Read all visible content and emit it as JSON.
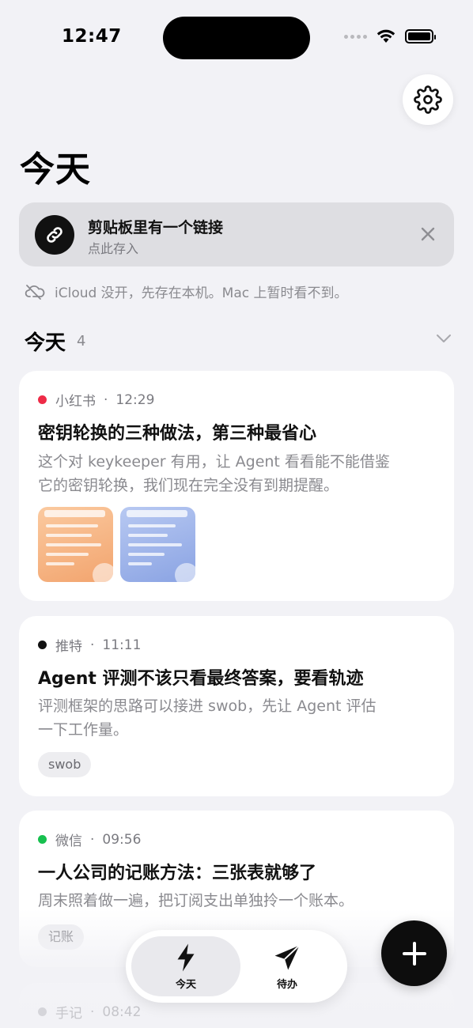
{
  "status_bar": {
    "time": "12:47"
  },
  "header": {
    "title": "今天",
    "settings_icon": "gear-icon"
  },
  "clipboard_banner": {
    "icon": "link-icon",
    "title": "剪贴板里有一个链接",
    "subtitle": "点此存入",
    "close_icon": "close-icon"
  },
  "icloud_notice": {
    "icon": "cloud-off-icon",
    "text": "iCloud 没开，先存在本机。Mac 上暂时看不到。"
  },
  "section": {
    "title": "今天",
    "count": "4"
  },
  "cards": [
    {
      "source": "小红书",
      "source_color": "#ee2b47",
      "time": "12:29",
      "title": "密钥轮换的三种做法，第三种最省心",
      "body_lines": [
        "这个对 keykeeper 有用，让 Agent 看看能不能借鉴",
        "它的密钥轮换，我们现在完全没有到期提醒。"
      ],
      "thumbnails": [
        "document-thumbnail-orange",
        "document-thumbnail-blue"
      ]
    },
    {
      "source": "推特",
      "source_color": "#111111",
      "time": "11:11",
      "title": "Agent 评测不该只看最终答案，要看轨迹",
      "body_lines": [
        "评测框架的思路可以接进 swob，先让 Agent 评估",
        "一下工作量。"
      ],
      "tag": "swob"
    },
    {
      "source": "微信",
      "source_color": "#17c04f",
      "time": "09:56",
      "title": "一人公司的记账方法：三张表就够了",
      "body_lines": [
        "周末照着做一遍，把订阅支出单独拎一个账本。"
      ],
      "tag": "记账"
    },
    {
      "source": "手记",
      "source_color": "#c5c5ca",
      "time": "08:42"
    }
  ],
  "tab_bar": {
    "tabs": [
      {
        "label": "今天",
        "icon": "lightning-icon",
        "selected": true
      },
      {
        "label": "待办",
        "icon": "paper-plane-icon",
        "selected": false
      }
    ]
  },
  "fab": {
    "icon": "plus-icon"
  },
  "meta_separator": "·"
}
